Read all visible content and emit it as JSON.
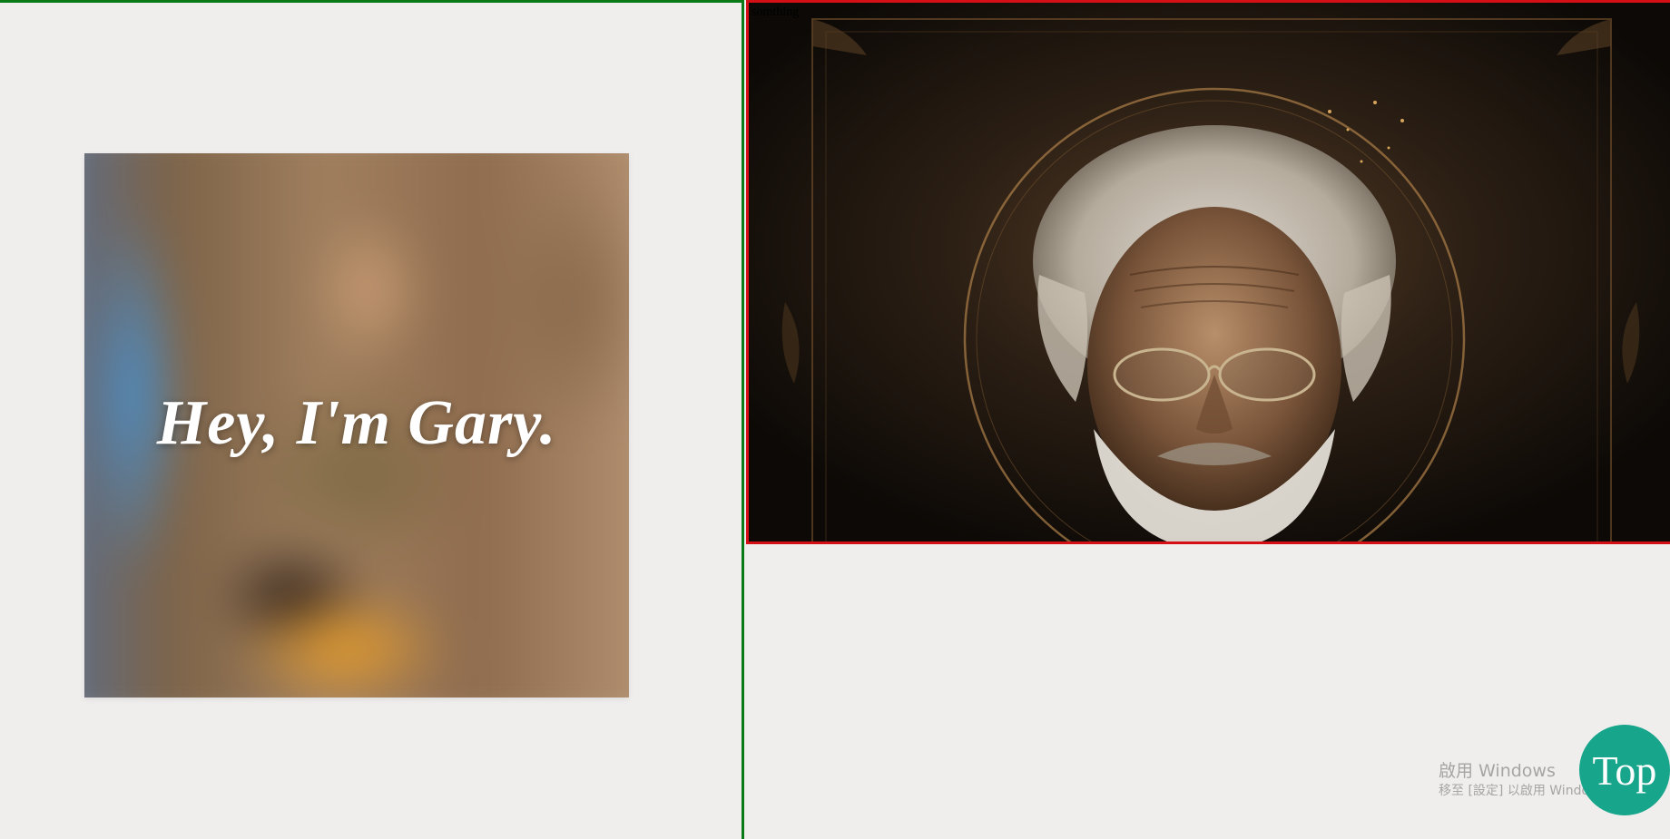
{
  "hero": {
    "title": "Hey, I'm Gary."
  },
  "frame": {
    "caption": "somthing"
  },
  "windows_watermark": {
    "title": "啟用 Windows",
    "subtitle": "移至 [設定] 以啟用 Windows。"
  },
  "top_button": {
    "label": "Top"
  },
  "colors": {
    "page_background": "#f0eeed",
    "left_border": "#0a7a16",
    "frame_border": "#d40f16",
    "top_button": "#17a58b"
  },
  "icons": [
    "old-man-portrait-image",
    "blurred-photo-background"
  ]
}
